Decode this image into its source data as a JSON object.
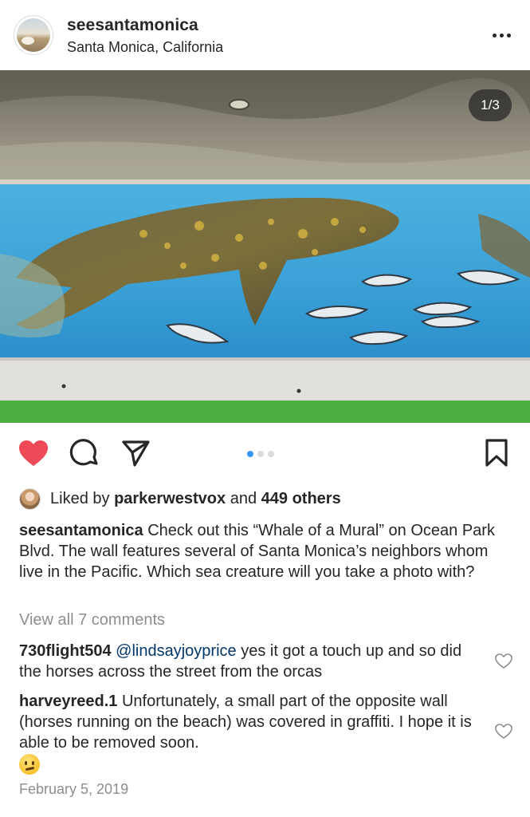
{
  "post": {
    "username": "seesantamonica",
    "location": "Santa Monica, California",
    "image_counter": "1/3",
    "carousel": {
      "total": 3,
      "active_index": 0
    }
  },
  "likes": {
    "prefix": "Liked by",
    "liker": "parkerwestvox",
    "conjunction": "and",
    "others": "449 others"
  },
  "caption": {
    "username": "seesantamonica",
    "text": "Check out this “Whale of a Mural” on Ocean Park Blvd. The wall features several of Santa Monica’s neighbors whom live in the Pacific. Which sea creature will you take a photo with?"
  },
  "view_all_comments": "View all 7 comments",
  "comments": [
    {
      "username": "730flight504",
      "mention": "@lindsayjoyprice",
      "text": "yes it got a touch up and so did the horses across the street from the orcas"
    },
    {
      "username": "harveyreed.1",
      "text": "Unfortunately, a small part of the opposite wall (horses running on the beach) was covered in graffiti.  I hope it is able to be removed soon."
    }
  ],
  "date": "February 5, 2019",
  "colors": {
    "like_red": "#ed4956",
    "carousel_active_blue": "#3897f0",
    "mention_blue": "#00376b",
    "muted_gray": "#8e8e8e"
  },
  "icons": {
    "like": "heart-filled-icon",
    "comment": "comment-bubble-icon",
    "share": "paper-plane-icon",
    "save": "bookmark-icon",
    "more": "more-horizontal-icon",
    "comment_like": "heart-outline-icon"
  }
}
